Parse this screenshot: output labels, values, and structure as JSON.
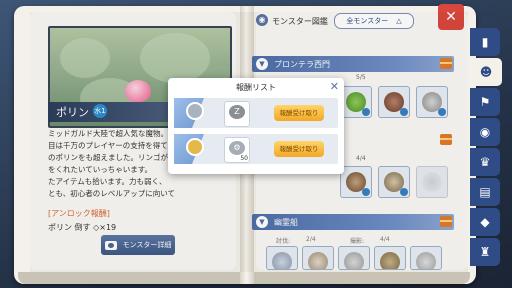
{
  "header": {
    "title": "モンスター図鑑",
    "filter_label": "全モンスター",
    "filter_icon": "triangle-icon",
    "close_icon": "close-icon"
  },
  "monster": {
    "name": "ポリン",
    "element": "水1",
    "description": [
      "ミッドガルド大陸で超人気な魔物。そ",
      "目は千万のプレイヤーの支持を得て",
      "のポリンをも超えました。リンゴが",
      "をくれたいていっちゃいます。",
      "たアイテムも拾います。力も弱く、",
      "とも、初心者のレベルアップに向いて"
    ],
    "unlock_label": "[アンロック報酬]",
    "unlock_value": "ポリン 倒す ◇×19",
    "detail_button": "モンスター詳細"
  },
  "regions": [
    {
      "name": "プロンテラ西門",
      "count": "5/5"
    },
    {
      "name": "",
      "count": "4/4"
    },
    {
      "name": "幽霊船",
      "count": "",
      "stats": [
        "討伐:",
        "2/4",
        "撮影:",
        "4/4"
      ]
    }
  ],
  "reward_dialog": {
    "title": "報酬リスト",
    "rows": [
      {
        "medal": "silver",
        "item_glyph": "Z",
        "qty": "",
        "button": "報酬受け取り"
      },
      {
        "medal": "gold",
        "item_glyph": "⚙",
        "qty": "50",
        "button": "報酬受け取り"
      }
    ]
  },
  "side_tabs": [
    "book-icon",
    "poring-icon",
    "flag-icon",
    "eye-icon",
    "chef-hat-icon",
    "card-icon",
    "tag-icon",
    "trophy-icon"
  ],
  "colors": {
    "accent": "#2f4c86",
    "close": "#d9473c",
    "button": "#f2a826",
    "unlock": "#d9682b"
  }
}
